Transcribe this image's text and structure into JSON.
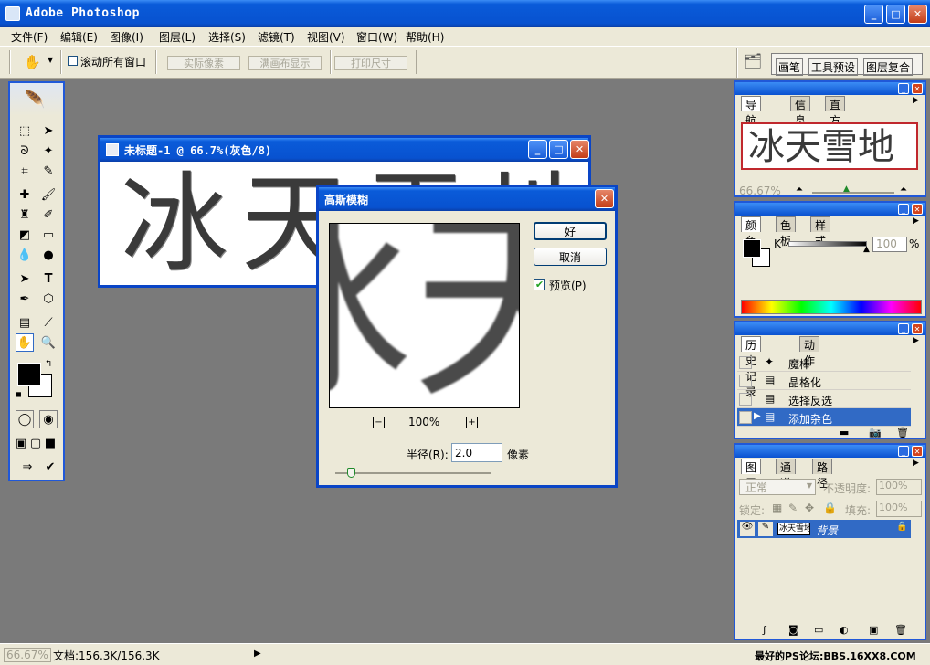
{
  "app": {
    "title": "Adobe Photoshop"
  },
  "menu": [
    "文件(F)",
    "编辑(E)",
    "图像(I)",
    "图层(L)",
    "选择(S)",
    "滤镜(T)",
    "视图(V)",
    "窗口(W)",
    "帮助(H)"
  ],
  "options": {
    "scroll_all_label": "滚动所有窗口",
    "actual_pixels": "实际像素",
    "fit_on_screen": "满画布显示",
    "print_size": "打印尺寸",
    "palette_tabs": [
      "画笔",
      "工具预设",
      "图层复合"
    ]
  },
  "document": {
    "title": "未标题-1 @ 66.7%(灰色/8)",
    "text": "冰天雪地"
  },
  "gaussian": {
    "title": "高斯模糊",
    "ok": "好",
    "cancel": "取消",
    "preview_label": "预览(P)",
    "zoom": "100%",
    "radius_label": "半径(R):",
    "radius_value": "2.0",
    "unit": "像素",
    "slider_fraction": 0.1
  },
  "navigator": {
    "tabs": [
      "导航器",
      "信息",
      "直方图"
    ],
    "thumb_text": "冰天雪地",
    "zoom": "66.67%"
  },
  "color": {
    "tabs": [
      "颜色",
      "色板",
      "样式"
    ],
    "channel": "K",
    "value": "100",
    "unit": "%"
  },
  "history": {
    "tabs": [
      "历史记录",
      "动作"
    ],
    "items": [
      "魔棒",
      "晶格化",
      "选择反选",
      "添加杂色"
    ]
  },
  "layers": {
    "tabs": [
      "图层",
      "通道",
      "路径"
    ],
    "blend_mode": "正常",
    "opacity_label": "不透明度:",
    "opacity": "100%",
    "lock_label": "锁定:",
    "fill_label": "填充:",
    "fill": "100%",
    "layer_name": "背景",
    "thumb_text": "冰天雪地"
  },
  "status": {
    "zoom": "66.67%",
    "doc": "文档:156.3K/156.3K",
    "watermark": "最好的PS论坛:BBS.16XX8.COM"
  }
}
